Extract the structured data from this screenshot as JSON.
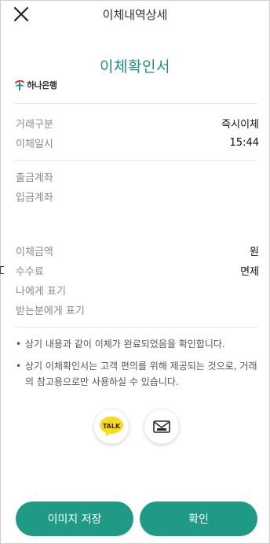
{
  "header": {
    "title": "이체내역상세"
  },
  "document": {
    "title": "이체확인서",
    "bank_name": "하나은행"
  },
  "rows": {
    "trade_type": {
      "label": "거래구분",
      "value": "즉시이체"
    },
    "transfer_datetime": {
      "label": "이체일시",
      "value": "15:44"
    },
    "withdraw_account": {
      "label": "출금계좌",
      "value": ""
    },
    "deposit_account": {
      "label": "입금계좌",
      "value": ""
    },
    "amount": {
      "label": "이체금액",
      "value": "원"
    },
    "fee": {
      "label": "수수료",
      "value": "면제"
    },
    "my_display": {
      "label": "나에게 표기",
      "value": ""
    },
    "recipient_display": {
      "label": "받는분에게 표기",
      "value": ""
    }
  },
  "notes": [
    "상기 내용과 같이 이체가 완료되었음을 확인합니다.",
    "상기 이체확인서는 고객 편의를 위해 제공되는 것으로, 거래의 참고용으로만 사용하실 수 있습니다."
  ],
  "share": {
    "kakao_label": "TALK",
    "kakao_color": "#3c1e1e",
    "message_icon": "envelope-icon"
  },
  "buttons": {
    "save_image": "이미지 저장",
    "confirm": "확인"
  },
  "colors": {
    "accent": "#1a9283",
    "button": "#1f9a84",
    "kakao_yellow": "#f6dc1a"
  }
}
